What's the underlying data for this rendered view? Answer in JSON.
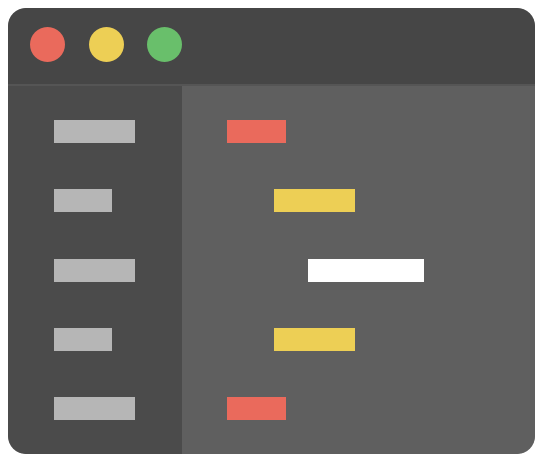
{
  "illustration": {
    "kind": "code-editor-window-icon",
    "colors": {
      "window_frame": "#464646",
      "sidebar": "#4b4b4b",
      "editor": "#5f5f5f",
      "placeholder_gray": "#b6b6b6",
      "red": "#ea6a5c",
      "yellow": "#edcf55",
      "green": "#69bf6b",
      "white": "#ffffff"
    },
    "window_controls": [
      {
        "name": "close",
        "color": "#ea6a5c"
      },
      {
        "name": "minimize",
        "color": "#edcf55"
      },
      {
        "name": "maximize",
        "color": "#69bf6b"
      }
    ],
    "sidebar_items": [
      {
        "size": "long"
      },
      {
        "size": "short"
      },
      {
        "size": "long"
      },
      {
        "size": "short"
      },
      {
        "size": "long"
      }
    ],
    "code_lines": [
      {
        "indent_level": 0,
        "color": "#ea6a5c"
      },
      {
        "indent_level": 1,
        "color": "#edcf55"
      },
      {
        "indent_level": 2,
        "color": "#ffffff"
      },
      {
        "indent_level": 1,
        "color": "#edcf55"
      },
      {
        "indent_level": 0,
        "color": "#ea6a5c"
      }
    ]
  }
}
